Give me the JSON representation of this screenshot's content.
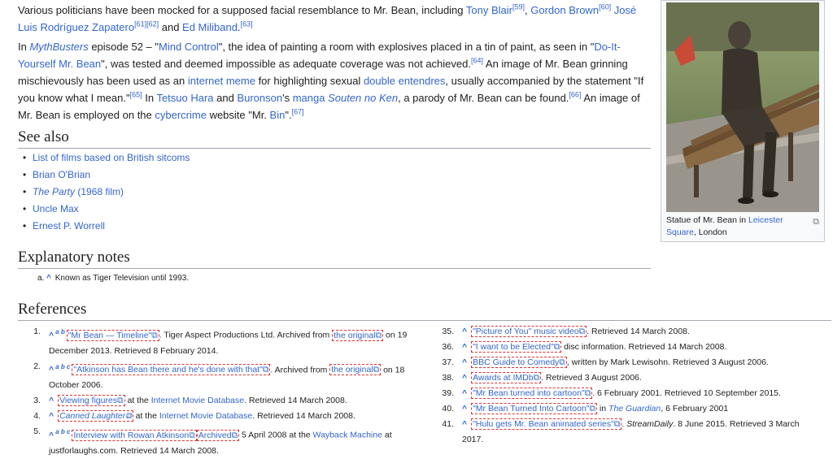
{
  "p1": {
    "t1": "Various politicians have been mocked for a supposed facial resemblance to Mr. Bean, including ",
    "blair": "Tony Blair",
    "s59": "[59]",
    "t2": ", ",
    "brown": "Gordon Brown",
    "s60": "[60]",
    "t3": " ",
    "zapatero": "José Luis Rodríguez Zapatero",
    "s61": "[61][62]",
    "t4": " and ",
    "miliband": "Ed Miliband",
    "t5": ".",
    "s63": "[63]"
  },
  "p2": {
    "mythbusters": "MythBusters",
    "t1": " episode 52 – \"",
    "mindcontrol": "Mind Control",
    "t2": "\", the idea of painting a room with explosives placed in a tin of paint, as seen in \"",
    "diy": "Do-It-Yourself Mr. Bean",
    "t3": "\", was tested and deemed impossible as adequate coverage was not achieved.",
    "s64": "[64]",
    "t4": " An image of Mr. Bean grinning mischievously has been used as an ",
    "meme": "internet meme",
    "t5": " for highlighting sexual ",
    "double": "double entendres",
    "t6": ", usually accompanied by the statement \"If you know what I mean.\"",
    "s65": "[65]",
    "t7": " In ",
    "hara": "Tetsuo Hara",
    "t8": " and ",
    "buronson": "Buronson",
    "t9": "'s ",
    "manga": "manga",
    "t10": " ",
    "souten": "Souten no Ken",
    "t11": ", a parody of Mr. Bean can be found.",
    "s66": "[66]",
    "t12": " An image of Mr. Bean is employed on the ",
    "cyber": "cybercrime",
    "t13": " website \"Mr. ",
    "bin": "Bin",
    "t14": "\".",
    "s67": "[67]"
  },
  "seealso": {
    "heading": "See also",
    "items": [
      "List of films based on British sitcoms",
      "Brian O'Brian",
      "The Party",
      " (1968 film)",
      "Uncle Max",
      "Ernest P. Worrell"
    ]
  },
  "notes": {
    "heading": "Explanatory notes",
    "a_label": "a.",
    "caret": "^",
    "text": "Known as Tiger Television until 1993."
  },
  "refs": {
    "heading": "References",
    "r1": {
      "num": "1.",
      "abc": "a b",
      "link": "\"Mr Bean — Timeline\"",
      "t1": ". Tiger Aspect Productions Ltd. Archived from ",
      "orig": "the original",
      "t2": " on 19 December 2013. Retrieved 8 February 2014."
    },
    "r2": {
      "num": "2.",
      "abc": "a b c",
      "link": "\"Atkinson has Bean there and he's done with that\"",
      "t1": ". Archived from ",
      "orig": "the original",
      "t2": " on 18 October 2006."
    },
    "r3": {
      "num": "3.",
      "link": "Viewing figures",
      "t1": " at the ",
      "imdb": "Internet Movie Database",
      "t2": ". Retrieved 14 March 2008."
    },
    "r4": {
      "num": "4.",
      "link": "Canned Laughter",
      "t1": " at the ",
      "imdb": "Internet Movie Database",
      "t2": ". Retrieved 14 March 2008."
    },
    "r5": {
      "num": "5.",
      "abc": "a b c",
      "link": "Interview with Rowan Atkinson",
      "archived": "Archived",
      "t1": " 5 April 2008 at the ",
      "wayback": "Wayback Machine",
      "t2": " at justforlaughs.com. Retrieved 14 March 2008."
    },
    "r35": {
      "num": "35.",
      "link": "\"Picture of You\" music video",
      "t1": ". Retrieved 14 March 2008."
    },
    "r36": {
      "num": "36.",
      "link": "\"I want to be Elected\"",
      "t1": " disc information. Retrieved 14 March 2008."
    },
    "r37": {
      "num": "37.",
      "link": "BBC Guide to Comedy",
      "t1": ", written by Mark Lewisohn. Retrieved 3 August 2006."
    },
    "r38": {
      "num": "38.",
      "link": "Awards at IMDb",
      "t1": ". Retrieved 3 August 2006."
    },
    "r39": {
      "num": "39.",
      "link": "\"Mr Bean turned into cartoon\"",
      "t1": ". 6 February 2001. Retrieved 10 September 2015."
    },
    "r40": {
      "num": "40.",
      "link": "\"Mr Bean Turned Into Cartoon\"",
      "t1": " in ",
      "guardian": "The Guardian",
      "t2": ", 6 February 2001"
    },
    "r41": {
      "num": "41.",
      "link": "\"Hulu gets Mr. Bean animated series\"",
      "t1": ". ",
      "daily": "StreamDaily",
      "t2": ". 8 June 2015. Retrieved 3 March 2017."
    }
  },
  "infobox": {
    "caption_t1": "Statue of Mr. Bean in ",
    "caption_link": "Leicester Square",
    "caption_t2": ", London",
    "enlarge_icon": "enlarge-icon"
  },
  "icons": {
    "external": "external-link-icon"
  }
}
